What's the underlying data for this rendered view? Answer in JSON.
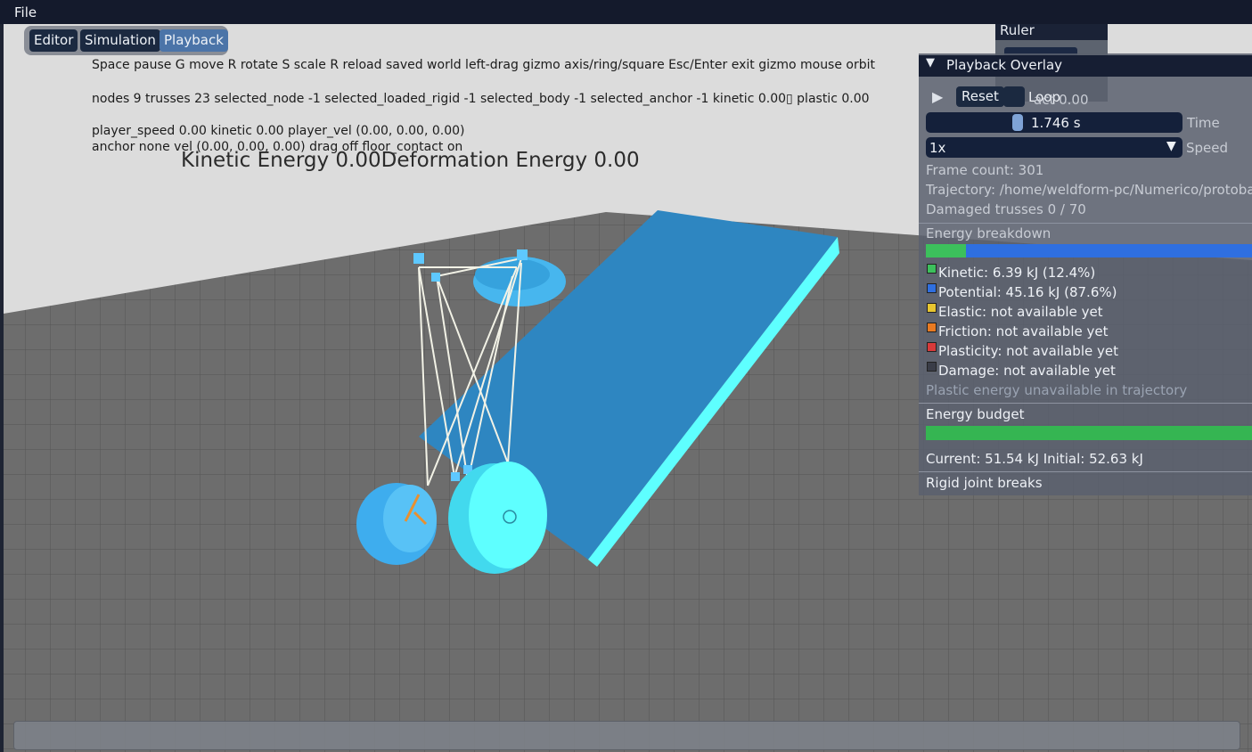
{
  "menu": {
    "file": "File"
  },
  "modes": {
    "editor": "Editor",
    "simulation": "Simulation",
    "playback": "Playback"
  },
  "hud": {
    "keys": "Space pause  G move  R rotate  S scale  R reload saved world  left-drag gizmo axis/ring/square  Esc/Enter exit gizmo  mouse orbit",
    "stats": "nodes 9   trusses 23   selected_node -1   selected_loaded_rigid -1   selected_body -1   selected_anchor -1   kinetic 0.00▯   plastic 0.00",
    "player": "player_speed 0.00   kinetic 0.00   player_vel (0.00, 0.00, 0.00)",
    "anchor": "anchor none   vel (0.00, 0.00, 0.00)   drag off   floor_contact on",
    "energy_line": "Kinetic Energy 0.00Deformation Energy 0.00"
  },
  "ruler": {
    "title": "Ruler",
    "overlap_text": "act 0.00"
  },
  "overlay": {
    "title": "Playback Overlay",
    "play_icon": "play-icon",
    "reset_label": "Reset",
    "loop_label": "Loop",
    "time_value": "1.746 s",
    "time_progress": 0.35,
    "time_label": "Time",
    "speed_value": "1x",
    "speed_label": "Speed",
    "frame_count": "Frame count: 301",
    "trajectory": "Trajectory: /home/weldform-pc/Numerico/protoba",
    "damaged_trusses": "Damaged trusses       0 / 70",
    "energy_breakdown_title": "Energy breakdown",
    "kinetic_fraction": 0.124,
    "potential_fraction": 0.876,
    "legend": [
      {
        "text": "Kinetic: 6.39 kJ (12.4%)",
        "color": "#3cc05c"
      },
      {
        "text": "Potential: 45.16 kJ (87.6%)",
        "color": "#2f6fe0"
      },
      {
        "text": "Elastic: not available yet",
        "color": "#e8c630"
      },
      {
        "text": "Friction: not available yet",
        "color": "#e87a22"
      },
      {
        "text": "Plasticity: not available yet",
        "color": "#d83a3a"
      },
      {
        "text": "Damage: not available yet",
        "color": "#3a3d48"
      }
    ],
    "plastic_note": "Plastic energy unavailable in trajectory",
    "budget_title": "Energy budget",
    "budget_fraction": 1.0,
    "budget_text": "Current: 51.54 kJ Initial: 52.63 kJ",
    "rigid_breaks": "Rigid joint breaks"
  },
  "colors": {
    "sky": "#dcdcdc",
    "floor": "#6e6e6e",
    "ramp": "#2e86c1",
    "ramp_edge": "#5effff",
    "wheel": "#5ef4ff",
    "truss": "#f2f2e6",
    "kinetic": "#3cc05c",
    "potential": "#2f6fe0",
    "budget": "#35b552"
  }
}
